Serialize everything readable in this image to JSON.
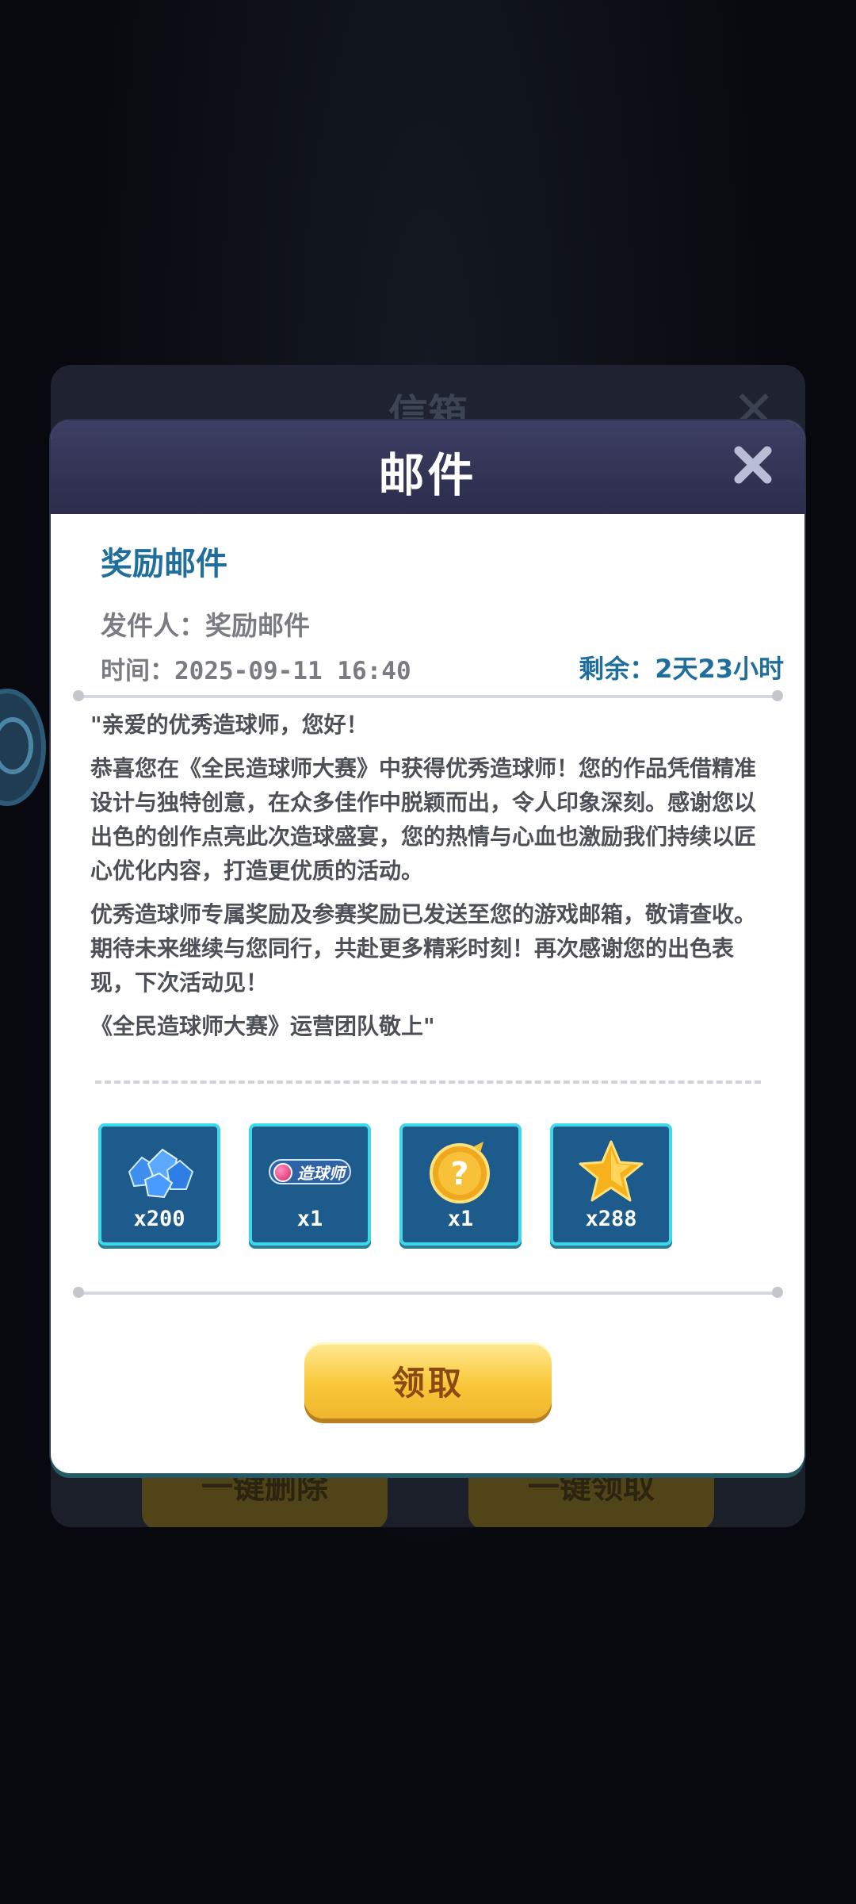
{
  "background": {
    "inbox_title": "信箱",
    "inbox_buttons": [
      "一键删除",
      "一键领取"
    ]
  },
  "dialog": {
    "title": "邮件",
    "mail_title": "奖励邮件",
    "sender": "发件人：奖励邮件",
    "time": "时间：2025-09-11 16:40",
    "remaining": "剩余：2天23小时",
    "paragraphs": [
      "\"亲爱的优秀造球师，您好！",
      "恭喜您在《全民造球师大赛》中获得优秀造球师！您的作品凭借精准设计与独特创意，在众多佳作中脱颖而出，令人印象深刻。感谢您以出色的创作点亮此次造球盛宴，您的热情与心血也激励我们持续以匠心优化内容，打造更优质的活动。",
      "优秀造球师专属奖励及参赛奖励已发送至您的游戏邮箱，敬请查收。期待未来继续与您同行，共赴更多精彩时刻！再次感谢您的出色表现，下次活动见！",
      "《全民造球师大赛》运营团队敬上\""
    ],
    "rewards": [
      {
        "icon": "blue-crystals-icon",
        "count": "x200"
      },
      {
        "icon": "designer-badge-icon",
        "label": "造球师",
        "count": "x1"
      },
      {
        "icon": "mystery-coin-icon",
        "count": "x1"
      },
      {
        "icon": "gold-star-icon",
        "count": "x288"
      }
    ],
    "claim_label": "领取"
  },
  "colors": {
    "header": "#33355a",
    "accent_blue": "#1f6e9c",
    "reward_tile": "#1c5b8c",
    "reward_border": "#3fd8e8",
    "claim_button": "#f9c83a"
  }
}
